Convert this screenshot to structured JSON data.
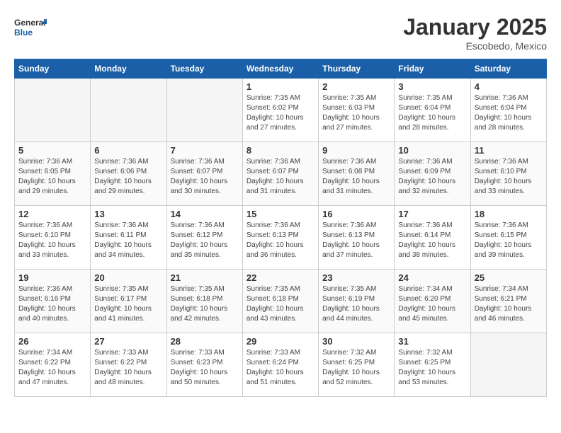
{
  "header": {
    "logo_general": "General",
    "logo_blue": "Blue",
    "title": "January 2025",
    "location": "Escobedo, Mexico"
  },
  "days_of_week": [
    "Sunday",
    "Monday",
    "Tuesday",
    "Wednesday",
    "Thursday",
    "Friday",
    "Saturday"
  ],
  "weeks": [
    {
      "days": [
        {
          "number": "",
          "info": ""
        },
        {
          "number": "",
          "info": ""
        },
        {
          "number": "",
          "info": ""
        },
        {
          "number": "1",
          "info": "Sunrise: 7:35 AM\nSunset: 6:02 PM\nDaylight: 10 hours\nand 27 minutes."
        },
        {
          "number": "2",
          "info": "Sunrise: 7:35 AM\nSunset: 6:03 PM\nDaylight: 10 hours\nand 27 minutes."
        },
        {
          "number": "3",
          "info": "Sunrise: 7:35 AM\nSunset: 6:04 PM\nDaylight: 10 hours\nand 28 minutes."
        },
        {
          "number": "4",
          "info": "Sunrise: 7:36 AM\nSunset: 6:04 PM\nDaylight: 10 hours\nand 28 minutes."
        }
      ]
    },
    {
      "days": [
        {
          "number": "5",
          "info": "Sunrise: 7:36 AM\nSunset: 6:05 PM\nDaylight: 10 hours\nand 29 minutes."
        },
        {
          "number": "6",
          "info": "Sunrise: 7:36 AM\nSunset: 6:06 PM\nDaylight: 10 hours\nand 29 minutes."
        },
        {
          "number": "7",
          "info": "Sunrise: 7:36 AM\nSunset: 6:07 PM\nDaylight: 10 hours\nand 30 minutes."
        },
        {
          "number": "8",
          "info": "Sunrise: 7:36 AM\nSunset: 6:07 PM\nDaylight: 10 hours\nand 31 minutes."
        },
        {
          "number": "9",
          "info": "Sunrise: 7:36 AM\nSunset: 6:08 PM\nDaylight: 10 hours\nand 31 minutes."
        },
        {
          "number": "10",
          "info": "Sunrise: 7:36 AM\nSunset: 6:09 PM\nDaylight: 10 hours\nand 32 minutes."
        },
        {
          "number": "11",
          "info": "Sunrise: 7:36 AM\nSunset: 6:10 PM\nDaylight: 10 hours\nand 33 minutes."
        }
      ]
    },
    {
      "days": [
        {
          "number": "12",
          "info": "Sunrise: 7:36 AM\nSunset: 6:10 PM\nDaylight: 10 hours\nand 33 minutes."
        },
        {
          "number": "13",
          "info": "Sunrise: 7:36 AM\nSunset: 6:11 PM\nDaylight: 10 hours\nand 34 minutes."
        },
        {
          "number": "14",
          "info": "Sunrise: 7:36 AM\nSunset: 6:12 PM\nDaylight: 10 hours\nand 35 minutes."
        },
        {
          "number": "15",
          "info": "Sunrise: 7:36 AM\nSunset: 6:13 PM\nDaylight: 10 hours\nand 36 minutes."
        },
        {
          "number": "16",
          "info": "Sunrise: 7:36 AM\nSunset: 6:13 PM\nDaylight: 10 hours\nand 37 minutes."
        },
        {
          "number": "17",
          "info": "Sunrise: 7:36 AM\nSunset: 6:14 PM\nDaylight: 10 hours\nand 38 minutes."
        },
        {
          "number": "18",
          "info": "Sunrise: 7:36 AM\nSunset: 6:15 PM\nDaylight: 10 hours\nand 39 minutes."
        }
      ]
    },
    {
      "days": [
        {
          "number": "19",
          "info": "Sunrise: 7:36 AM\nSunset: 6:16 PM\nDaylight: 10 hours\nand 40 minutes."
        },
        {
          "number": "20",
          "info": "Sunrise: 7:35 AM\nSunset: 6:17 PM\nDaylight: 10 hours\nand 41 minutes."
        },
        {
          "number": "21",
          "info": "Sunrise: 7:35 AM\nSunset: 6:18 PM\nDaylight: 10 hours\nand 42 minutes."
        },
        {
          "number": "22",
          "info": "Sunrise: 7:35 AM\nSunset: 6:18 PM\nDaylight: 10 hours\nand 43 minutes."
        },
        {
          "number": "23",
          "info": "Sunrise: 7:35 AM\nSunset: 6:19 PM\nDaylight: 10 hours\nand 44 minutes."
        },
        {
          "number": "24",
          "info": "Sunrise: 7:34 AM\nSunset: 6:20 PM\nDaylight: 10 hours\nand 45 minutes."
        },
        {
          "number": "25",
          "info": "Sunrise: 7:34 AM\nSunset: 6:21 PM\nDaylight: 10 hours\nand 46 minutes."
        }
      ]
    },
    {
      "days": [
        {
          "number": "26",
          "info": "Sunrise: 7:34 AM\nSunset: 6:22 PM\nDaylight: 10 hours\nand 47 minutes."
        },
        {
          "number": "27",
          "info": "Sunrise: 7:33 AM\nSunset: 6:22 PM\nDaylight: 10 hours\nand 48 minutes."
        },
        {
          "number": "28",
          "info": "Sunrise: 7:33 AM\nSunset: 6:23 PM\nDaylight: 10 hours\nand 50 minutes."
        },
        {
          "number": "29",
          "info": "Sunrise: 7:33 AM\nSunset: 6:24 PM\nDaylight: 10 hours\nand 51 minutes."
        },
        {
          "number": "30",
          "info": "Sunrise: 7:32 AM\nSunset: 6:25 PM\nDaylight: 10 hours\nand 52 minutes."
        },
        {
          "number": "31",
          "info": "Sunrise: 7:32 AM\nSunset: 6:25 PM\nDaylight: 10 hours\nand 53 minutes."
        },
        {
          "number": "",
          "info": ""
        }
      ]
    }
  ]
}
